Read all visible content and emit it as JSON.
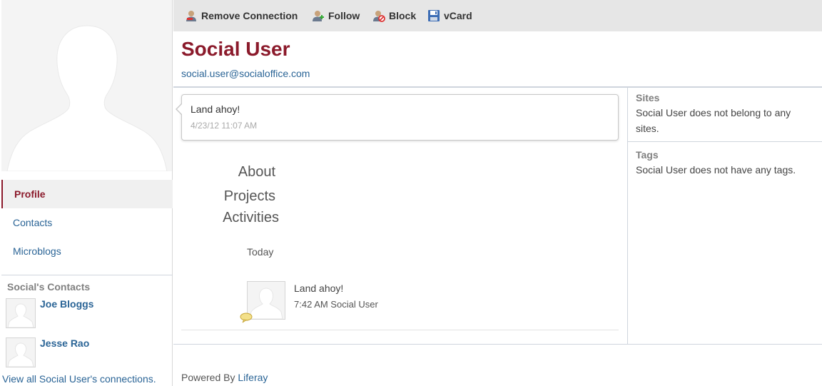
{
  "toolbar": {
    "remove_label": "Remove Connection",
    "follow_label": "Follow",
    "block_label": "Block",
    "vcard_label": "vCard"
  },
  "profile": {
    "name": "Social User",
    "email": "social.user@socialoffice.com"
  },
  "sidebar": {
    "items": [
      {
        "label": "Profile",
        "active": true
      },
      {
        "label": "Contacts"
      },
      {
        "label": "Microblogs"
      }
    ],
    "contacts_heading": "Social's Contacts",
    "contacts": [
      {
        "name": "Joe Bloggs"
      },
      {
        "name": "Jesse Rao"
      }
    ],
    "view_all": "View all Social User's connections."
  },
  "status": {
    "text": "Land ahoy!",
    "time": "4/23/12 11:07 AM"
  },
  "sections": {
    "about": "About",
    "projects": "Projects",
    "activities": "Activities"
  },
  "activity": {
    "day": "Today",
    "text": "Land ahoy!",
    "meta": "7:42 AM Social User"
  },
  "right": {
    "sites_title": "Sites",
    "sites_text": "Social User does not belong to any sites.",
    "tags_title": "Tags",
    "tags_text": "Social User does not have any tags."
  },
  "footer": {
    "prefix": "Powered By ",
    "link": "Liferay"
  },
  "colors": {
    "accent": "#8b1a2b",
    "link": "#2a6496",
    "toolbar_bg": "#e6e6e6"
  },
  "icons": [
    "remove-connection-icon",
    "follow-icon",
    "block-icon",
    "vcard-icon",
    "comment-bubble-icon"
  ]
}
